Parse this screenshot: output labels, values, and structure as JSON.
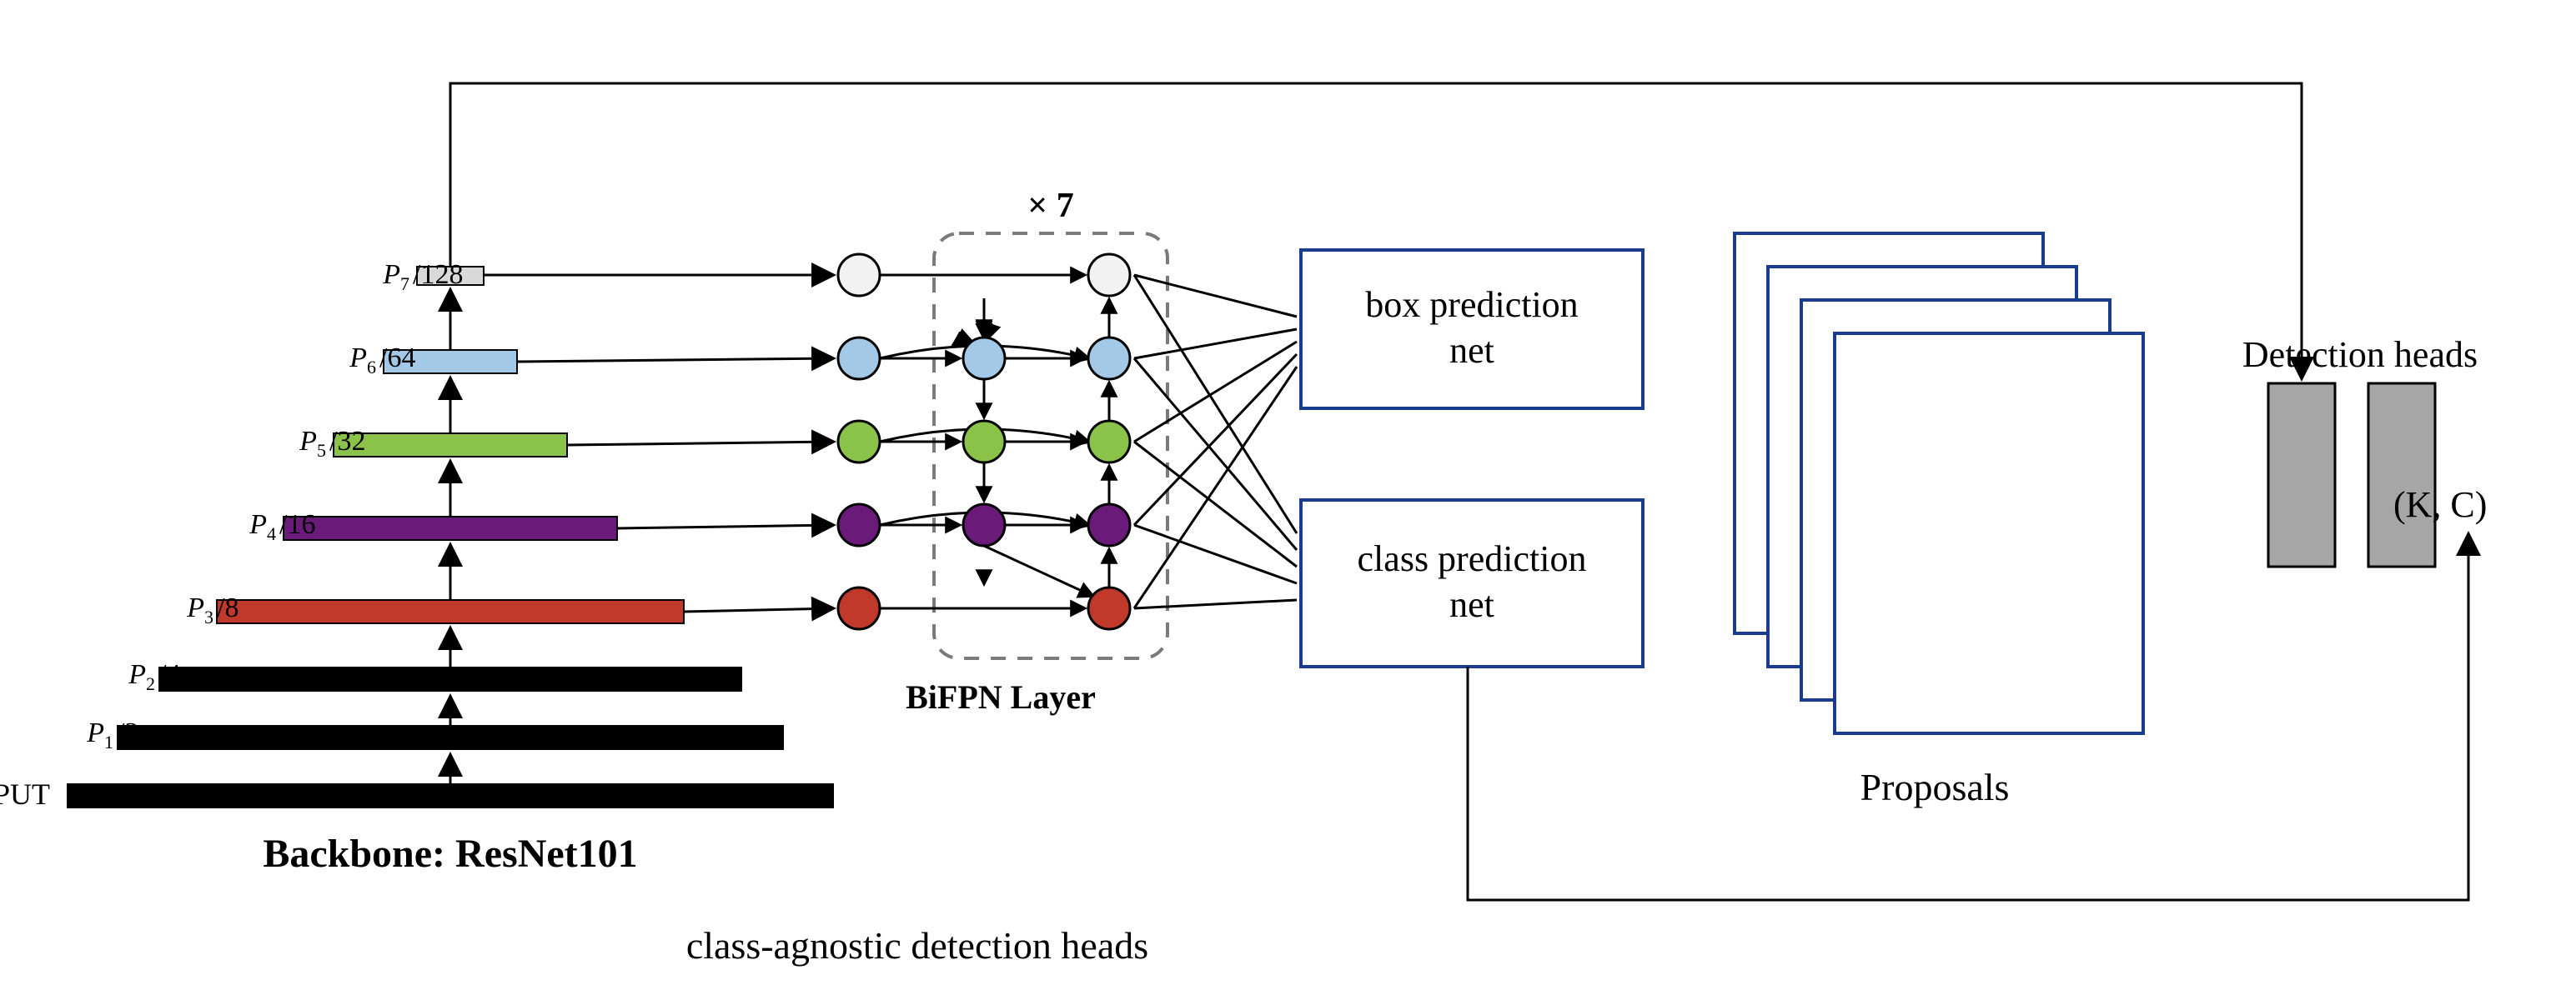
{
  "backbone": {
    "label": "Backbone: ResNet101",
    "input_label": "INPUT",
    "levels": [
      {
        "name": "P1",
        "sub": "1",
        "divider": "/2"
      },
      {
        "name": "P2",
        "sub": "2",
        "divider": "/4"
      },
      {
        "name": "P3",
        "sub": "3",
        "divider": "/8"
      },
      {
        "name": "P4",
        "sub": "4",
        "divider": "/16"
      },
      {
        "name": "P5",
        "sub": "5",
        "divider": "/32"
      },
      {
        "name": "P6",
        "sub": "6",
        "divider": "/64"
      },
      {
        "name": "P7",
        "sub": "7",
        "divider": "/128"
      }
    ]
  },
  "bifpn": {
    "multiplier": "× 7",
    "label": "BiFPN Layer"
  },
  "heads": {
    "box": {
      "line1": "box prediction",
      "line2": "net"
    },
    "cls": {
      "line1": "class prediction",
      "line2": "net"
    }
  },
  "proposals": {
    "label": "Proposals"
  },
  "detection_heads": {
    "label": "Detection heads",
    "output": "(K, C)"
  },
  "bottom_label": "class-agnostic detection heads",
  "colors": {
    "black": "#000000",
    "red": "#c0392b",
    "purple": "#6a1b7a",
    "green": "#8bc34a",
    "blue": "#a3c9e6",
    "gray": "#d9d9d9",
    "white": "#f2f2f2",
    "navybox": "#1a3c8c",
    "headgray": "#a6a6a6"
  }
}
